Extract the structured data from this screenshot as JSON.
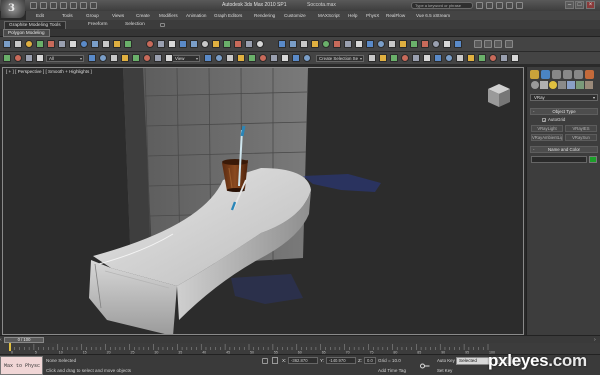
{
  "window": {
    "title": "Autodesk 3ds Max 2010 SP1",
    "file": "Soccota.max",
    "search_placeholder": "Type a keyword or phrase",
    "logo_letter": "3"
  },
  "menu": {
    "items": [
      "Edit",
      "Tools",
      "Group",
      "Views",
      "Create",
      "Modifiers",
      "Animation",
      "Graph Editors",
      "Rendering",
      "Customize",
      "MAXScript",
      "Help",
      "PhysX",
      "RealFlow",
      "Vue 6.5 xStream"
    ]
  },
  "ribbon": {
    "tabs": [
      "Graphite Modeling Tools",
      "Freeform",
      "Selection"
    ],
    "active_tab": "Graphite Modeling Tools",
    "panel_button": "Polygon Modeling"
  },
  "toolbar": {
    "selection_filter": "All",
    "reference_coord": "View",
    "named_selection": "Create Selection Se"
  },
  "viewport": {
    "label": "[ + ] [ Perspective ] [ Smooth + Highlights ]",
    "background": "#2c2c2c"
  },
  "command_panel": {
    "category_dropdown": "VRay",
    "object_type_header": "Object Type",
    "autogrid_label": "AutoGrid",
    "autogrid_checked": true,
    "object_buttons": [
      "VRayLight",
      "VRayIES",
      "VRayAmbientLig",
      "VRaySun"
    ],
    "name_color_header": "Name and Color",
    "object_color": "#1c9f2a"
  },
  "time": {
    "current": "0 / 100",
    "ticks": [
      "0",
      "5",
      "10",
      "15",
      "20",
      "25",
      "30",
      "35",
      "40",
      "45",
      "50",
      "55",
      "60",
      "65",
      "70",
      "75",
      "80",
      "85",
      "90",
      "95",
      "100"
    ]
  },
  "status": {
    "maxscript": "Max to Physc",
    "selection_info": "None Selected",
    "prompt": "Click and drag to select and move objects",
    "x_label": "X:",
    "x_value": "-362.870",
    "y_label": "Y:",
    "y_value": "-140.970",
    "z_label": "Z:",
    "z_value": "0.0",
    "grid": "Grid = 10.0",
    "add_time_tag": "Add Time Tag",
    "auto_key": "Auto Key",
    "set_key": "Set Key",
    "key_filter": "Selected"
  },
  "watermark": {
    "main": "pxleyes",
    "suffix": ".com"
  }
}
